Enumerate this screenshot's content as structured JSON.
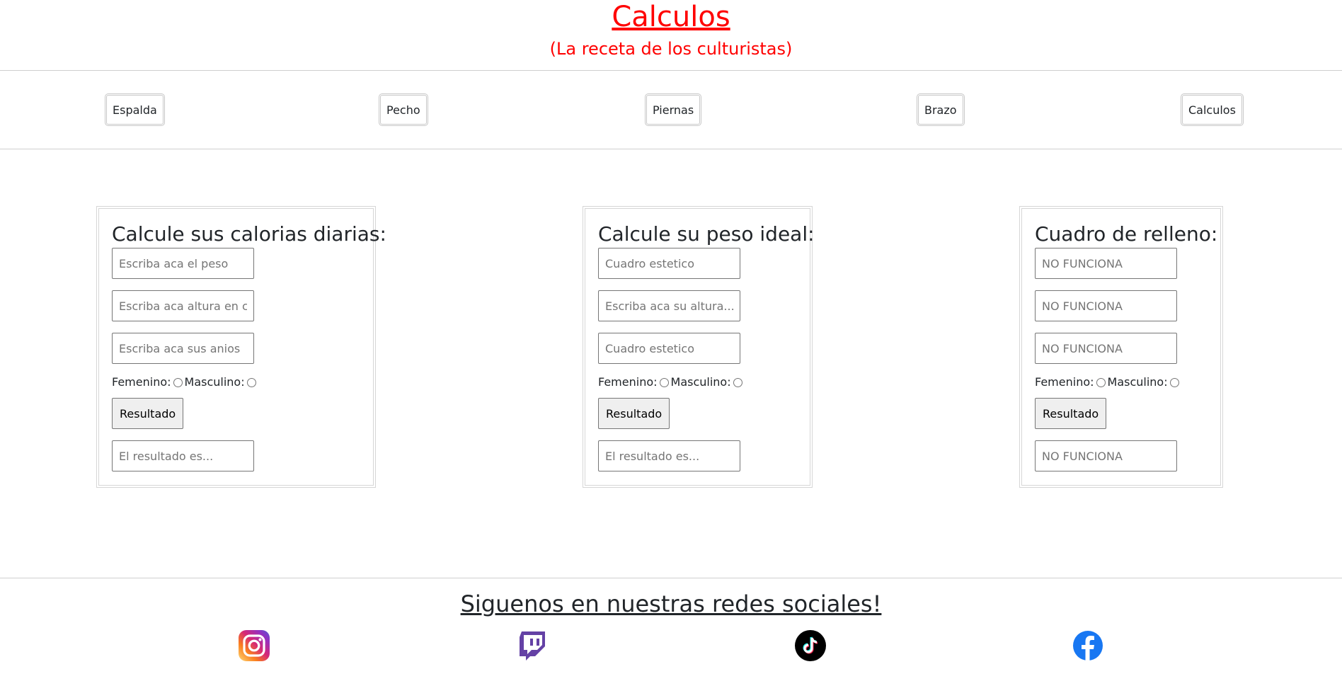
{
  "header": {
    "title": "Calculos",
    "subtitle": "(La receta de los culturistas)"
  },
  "nav": {
    "items": [
      {
        "label": "Espalda"
      },
      {
        "label": "Pecho"
      },
      {
        "label": "Piernas"
      },
      {
        "label": "Brazo"
      },
      {
        "label": "Calculos"
      }
    ]
  },
  "cards": [
    {
      "title": "Calcule sus calorias diarias:",
      "fields": [
        {
          "placeholder": "Escriba aca el peso"
        },
        {
          "placeholder": "Escriba aca altura en cm"
        },
        {
          "placeholder": "Escriba aca sus anios"
        }
      ],
      "female_label": "Femenino:",
      "male_label": "Masculino:",
      "button_label": "Resultado",
      "result_placeholder": "El resultado es..."
    },
    {
      "title": "Calcule su peso ideal:",
      "fields": [
        {
          "placeholder": "Cuadro estetico"
        },
        {
          "placeholder": "Escriba aca su altura..."
        },
        {
          "placeholder": "Cuadro estetico"
        }
      ],
      "female_label": "Femenino:",
      "male_label": "Masculino:",
      "button_label": "Resultado",
      "result_placeholder": "El resultado es..."
    },
    {
      "title": "Cuadro de relleno:",
      "fields": [
        {
          "placeholder": "NO FUNCIONA"
        },
        {
          "placeholder": "NO FUNCIONA"
        },
        {
          "placeholder": "NO FUNCIONA"
        }
      ],
      "female_label": "Femenino:",
      "male_label": "Masculino:",
      "button_label": "Resultado",
      "result_placeholder": "NO FUNCIONA"
    }
  ],
  "footer": {
    "title": "Siguenos en nuestras redes sociales!",
    "socials": [
      {
        "icon": "instagram-icon"
      },
      {
        "icon": "twitch-icon"
      },
      {
        "icon": "tiktok-icon"
      },
      {
        "icon": "facebook-icon"
      }
    ]
  },
  "colors": {
    "accent": "#ff0000",
    "twitch": "#6441a5",
    "facebook": "#1877f2"
  }
}
